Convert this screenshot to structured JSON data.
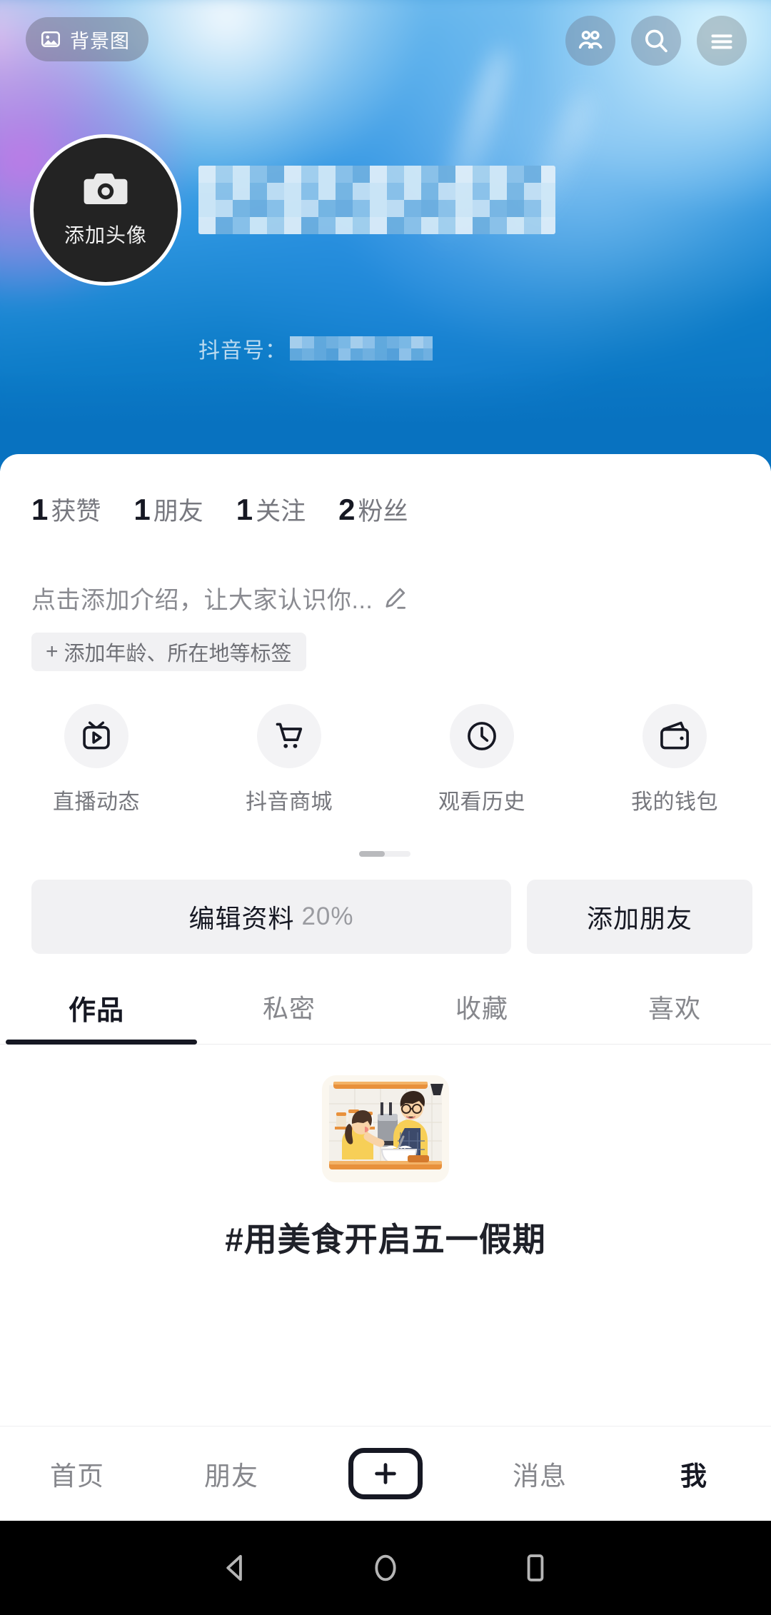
{
  "cover": {
    "badge_label": "背景图",
    "badge_icon": "image-icon",
    "header_icons": [
      "friends-icon",
      "search-icon",
      "menu-icon"
    ]
  },
  "profile": {
    "avatar_label": "添加头像",
    "avatar_icon": "camera-icon",
    "display_name_redacted": true,
    "uid_label": "抖音号：",
    "uid_value_redacted": "2•••••••"
  },
  "stats": [
    {
      "num": "1",
      "label": "获赞"
    },
    {
      "num": "1",
      "label": "朋友"
    },
    {
      "num": "1",
      "label": "关注"
    },
    {
      "num": "2",
      "label": "粉丝"
    }
  ],
  "bio": {
    "placeholder": "点击添加介绍，让大家认识你...",
    "edit_icon": "pencil-icon",
    "tag_plus": "+",
    "tag_label": "添加年龄、所在地等标签"
  },
  "quick_actions": [
    {
      "label": "直播动态",
      "icon": "live-tv-icon"
    },
    {
      "label": "抖音商城",
      "icon": "cart-icon"
    },
    {
      "label": "观看历史",
      "icon": "clock-icon"
    },
    {
      "label": "我的钱包",
      "icon": "wallet-icon"
    }
  ],
  "action_buttons": {
    "edit_profile": "编辑资料",
    "edit_profile_percent": "20%",
    "add_friend": "添加朋友"
  },
  "tabs": [
    {
      "label": "作品",
      "active": true
    },
    {
      "label": "私密",
      "active": false
    },
    {
      "label": "收藏",
      "active": false
    },
    {
      "label": "喜欢",
      "active": false
    }
  ],
  "empty_state": {
    "illustration": "cooking-couple-illustration",
    "title": "#用美食开启五一假期"
  },
  "tabbar": [
    {
      "label": "首页",
      "active": false
    },
    {
      "label": "朋友",
      "active": false
    },
    {
      "label": "",
      "active": false,
      "icon": "plus-icon"
    },
    {
      "label": "消息",
      "active": false
    },
    {
      "label": "我",
      "active": true
    }
  ],
  "system_nav": [
    "back-icon",
    "home-icon",
    "recents-icon"
  ],
  "colors": {
    "cover_blue": "#0872c0",
    "text_primary": "#161823",
    "text_secondary": "#86878c",
    "chip_bg": "#f1f1f3",
    "accent_orange": "#e8913c"
  }
}
